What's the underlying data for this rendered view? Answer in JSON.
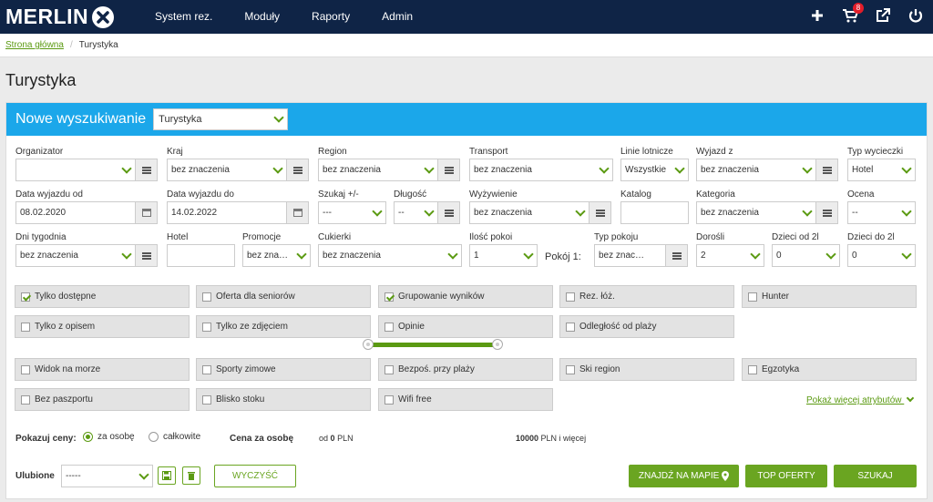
{
  "nav": {
    "logo": "MERLIN",
    "links": [
      "System rez.",
      "Moduły",
      "Raporty",
      "Admin"
    ],
    "cart_count": "8"
  },
  "breadcrumb": {
    "home": "Strona główna",
    "current": "Turystyka"
  },
  "page_title": "Turystyka",
  "search": {
    "header": "Nowe wyszukiwanie",
    "type_value": "Turystyka"
  },
  "fields": {
    "organizator": {
      "label": "Organizator",
      "value": ""
    },
    "kraj": {
      "label": "Kraj",
      "value": "bez znaczenia"
    },
    "region": {
      "label": "Region",
      "value": "bez znaczenia"
    },
    "transport": {
      "label": "Transport",
      "value": "bez znaczenia"
    },
    "linie": {
      "label": "Linie lotnicze",
      "value": "Wszystkie"
    },
    "wyjazd_z": {
      "label": "Wyjazd z",
      "value": "bez znaczenia"
    },
    "typ_wycieczki": {
      "label": "Typ wycieczki",
      "value": "Hotel"
    },
    "data_od": {
      "label": "Data wyjazdu od",
      "value": "08.02.2020"
    },
    "data_do": {
      "label": "Data wyjazdu do",
      "value": "14.02.2022"
    },
    "szukaj": {
      "label": "Szukaj +/-",
      "value": "---"
    },
    "dlugosc": {
      "label": "Długość",
      "value": "--"
    },
    "wyzywienie": {
      "label": "Wyżywienie",
      "value": "bez znaczenia"
    },
    "katalog": {
      "label": "Katalog",
      "value": ""
    },
    "kategoria": {
      "label": "Kategoria",
      "value": "bez znaczenia"
    },
    "ocena": {
      "label": "Ocena",
      "value": "--"
    },
    "dni": {
      "label": "Dni tygodnia",
      "value": "bez znaczenia"
    },
    "hotel": {
      "label": "Hotel",
      "value": ""
    },
    "promocje": {
      "label": "Promocje",
      "value": "bez znaczenia"
    },
    "cukierki": {
      "label": "Cukierki",
      "value": "bez znaczenia"
    },
    "ilosc_pokoi": {
      "label": "Ilość pokoi",
      "value": "1"
    },
    "pokoj": {
      "label": "Pokój 1:"
    },
    "typ_pokoju": {
      "label": "Typ pokoju",
      "value": "bez znaczenia"
    },
    "dorosli": {
      "label": "Dorośli",
      "value": "2"
    },
    "dzieci_od": {
      "label": "Dzieci od 2l",
      "value": "0"
    },
    "dzieci_do": {
      "label": "Dzieci do 2l",
      "value": "0"
    }
  },
  "attributes": [
    {
      "label": "Tylko dostępne",
      "checked": true
    },
    {
      "label": "Oferta dla seniorów",
      "checked": false
    },
    {
      "label": "Grupowanie wyników",
      "checked": true
    },
    {
      "label": "Rez. łóż.",
      "checked": false
    },
    {
      "label": "Hunter",
      "checked": false
    },
    {
      "label": "Tylko z opisem",
      "checked": false
    },
    {
      "label": "Tylko ze zdjęciem",
      "checked": false
    },
    {
      "label": "Opinie",
      "checked": false
    },
    {
      "label": "Odległość od plaży",
      "checked": false
    },
    {
      "label": "Widok na morze",
      "checked": false
    },
    {
      "label": "Sporty zimowe",
      "checked": false
    },
    {
      "label": "Bezpoś. przy plaży",
      "checked": false
    },
    {
      "label": "Ski region",
      "checked": false
    },
    {
      "label": "Egzotyka",
      "checked": false
    },
    {
      "label": "Bez paszportu",
      "checked": false
    },
    {
      "label": "Blisko stoku",
      "checked": false
    },
    {
      "label": "Wifi free",
      "checked": false
    }
  ],
  "more_attributes": "Pokaż więcej atrybutów",
  "prices": {
    "label": "Pokazuj ceny:",
    "opt1": "za osobę",
    "opt2": "całkowite",
    "per_person_label": "Cena za osobę",
    "from_prefix": "od",
    "from_value": "0",
    "from_unit": "PLN",
    "to_value": "10000",
    "to_suffix": "PLN i więcej"
  },
  "favorites": {
    "label": "Ulubione",
    "value": "-----"
  },
  "buttons": {
    "clear": "WYCZYŚĆ",
    "map": "ZNAJDŹ NA MAPIE",
    "top": "TOP OFERTY",
    "search": "SZUKAJ"
  }
}
